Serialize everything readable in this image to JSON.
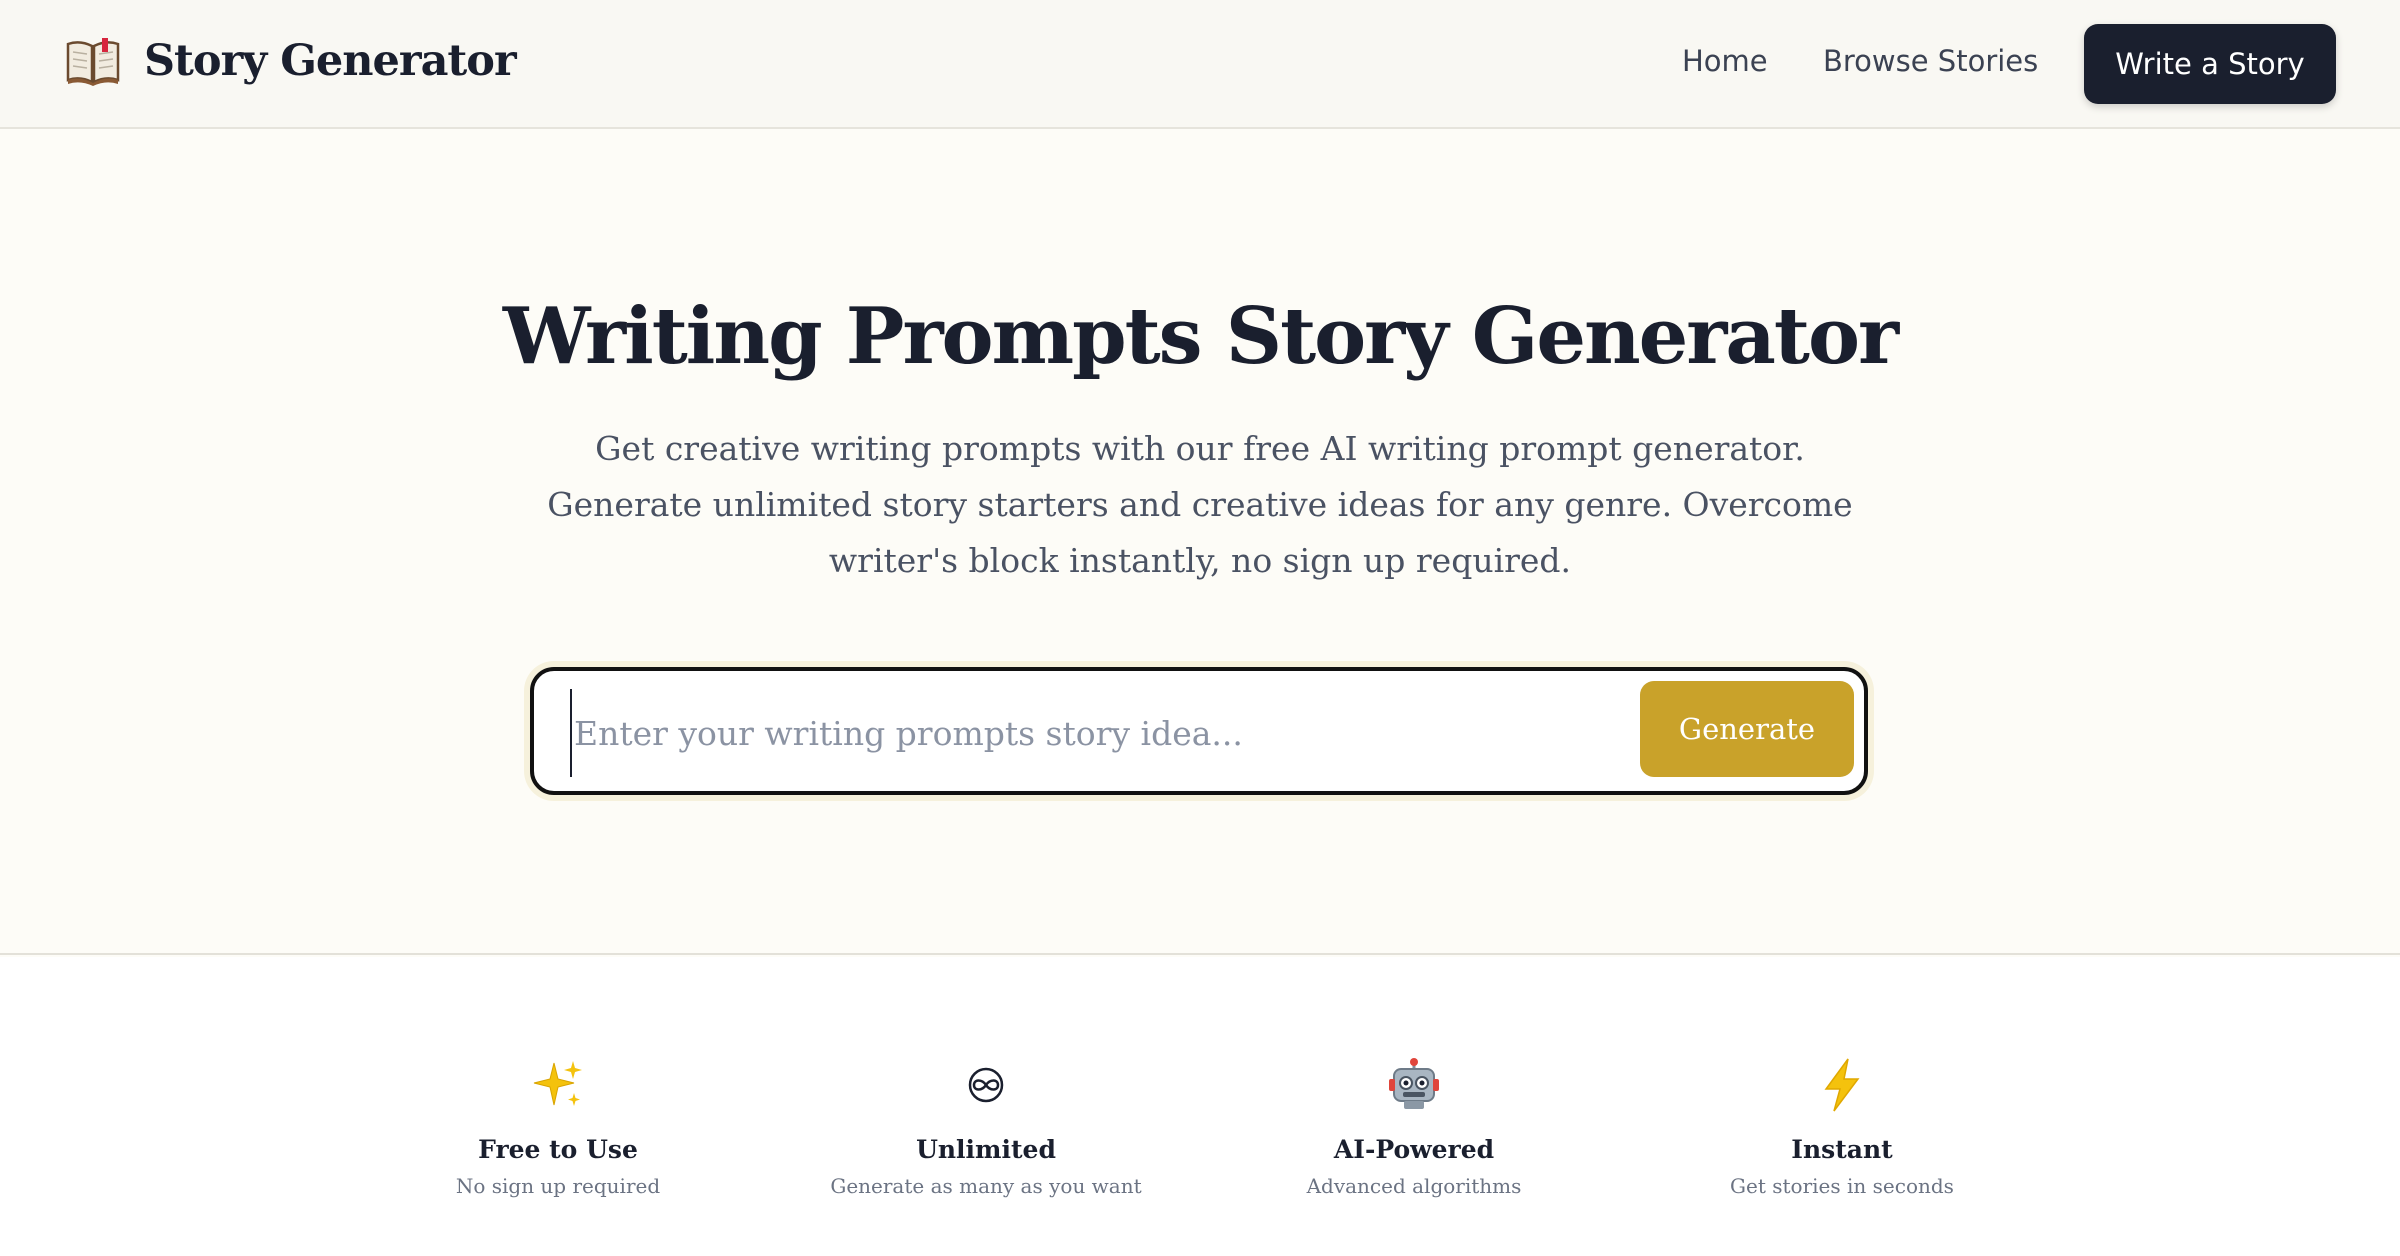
{
  "nav": {
    "brand_name": "Story Generator",
    "brand_icon": "open-book-icon",
    "links": [
      "Home",
      "Browse Stories"
    ],
    "cta_label": "Write a Story"
  },
  "hero": {
    "title": "Writing Prompts Story Generator",
    "subtitle": "Get creative writing prompts with our free AI writing prompt generator. Generate unlimited story starters and creative ideas for any genre. Overcome writer's block instantly, no sign up required.",
    "input_placeholder": "Enter your writing prompts story idea...",
    "input_value": "",
    "generate_label": "Generate"
  },
  "features": [
    {
      "icon": "sparkles-icon",
      "title": "Free to Use",
      "desc": "No sign up required"
    },
    {
      "icon": "infinity-icon",
      "title": "Unlimited",
      "desc": "Generate as many as you want"
    },
    {
      "icon": "robot-icon",
      "title": "AI-Powered",
      "desc": "Advanced algorithms"
    },
    {
      "icon": "lightning-icon",
      "title": "Instant",
      "desc": "Get stories in seconds"
    }
  ],
  "colors": {
    "primary_dark": "#1a1f2e",
    "accent_gold": "#c9a22a",
    "page_bg": "#fdfcf7",
    "nav_bg": "#f9f8f3"
  }
}
